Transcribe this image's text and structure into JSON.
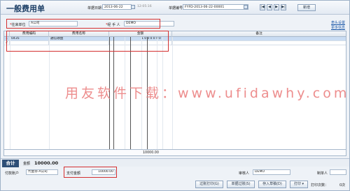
{
  "form": {
    "title": "一般费用单",
    "doc_date_label": "单据日期",
    "doc_date": "2013-06-22",
    "doc_time": "12:05:16",
    "doc_no_label": "单据编号",
    "doc_no": "FYFD-2013-06-22-00001",
    "nav": [
      "|◀",
      "◀",
      "▶",
      "▶|"
    ],
    "new_label": "新增"
  },
  "party": {
    "unit_label": "往来单位",
    "unit_value": "A公司",
    "handler_label": "经 手 人",
    "handler_value": "DEMO",
    "links": [
      "表头设置",
      "更多信息"
    ]
  },
  "grid": {
    "columns": [
      "",
      "费用编码",
      "费用名称",
      "金额",
      "备注"
    ],
    "rows": [
      {
        "no": "1",
        "code": "0435",
        "name": "通信收益",
        "amount": "1000000"
      },
      {
        "no": "2",
        "code": "",
        "name": "",
        "amount": ""
      }
    ],
    "footer_total": "10000.00"
  },
  "watermark": "用友软件下载：www.ufidawhy.com",
  "summary": {
    "tab": "合计",
    "amount_label": "金额",
    "amount": "10000.00"
  },
  "bottom": {
    "pay_account_label": "付款账户",
    "pay_account": "代金券-A公司",
    "pay_amount_label": "支付金额",
    "pay_amount": "10000.00",
    "reviewer_label": "审核人",
    "reviewer": "DEMO",
    "maker_label": "制单人"
  },
  "actions": {
    "print_preview": "过账打印(G)",
    "post": "单据过账(S)",
    "save_draft": "存入草稿(D)",
    "print": "打印",
    "print_count_label": "打印次数：",
    "print_count": "0次"
  }
}
